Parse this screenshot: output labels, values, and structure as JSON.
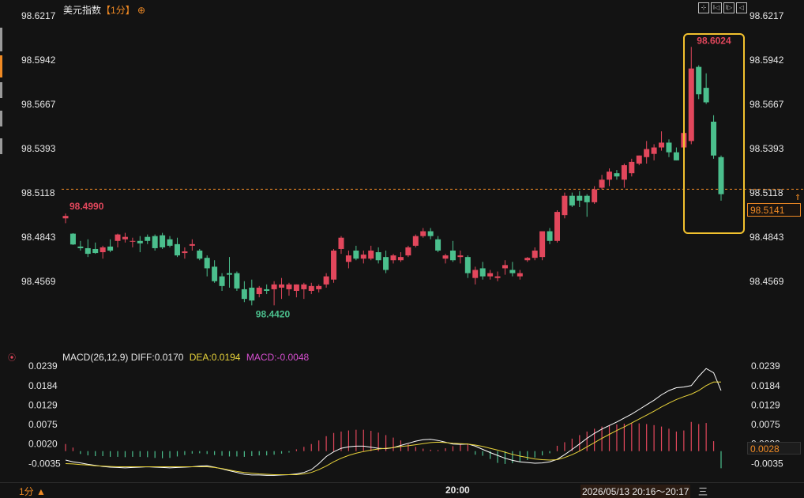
{
  "header": {
    "title": "美元指数",
    "period_tag": "【1分】",
    "toolbar": [
      "⊹",
      "I◁",
      "I▷",
      "◁"
    ]
  },
  "colors": {
    "up": "#e2475c",
    "down": "#4bbf8d",
    "highlight": "#f2c12e",
    "accent": "#f08a24",
    "diff_line": "#ffffff",
    "dea_line": "#e8d33a",
    "macd_label": "#d64fd0"
  },
  "chart_data": [
    {
      "type": "candlestick",
      "title": "美元指数【1分】",
      "ylim": [
        98.4294,
        98.6217
      ],
      "y_ticks": [
        "98.6217",
        "98.5942",
        "98.5667",
        "98.5393",
        "98.5118",
        "98.4843",
        "98.4569"
      ],
      "x_label": "20:00",
      "reference_line": 98.5141,
      "last_price_label": "98.5141",
      "annotations": {
        "high": "98.6024",
        "low": "98.4420",
        "start_high": "98.4990"
      },
      "candles": [
        {
          "o": 98.496,
          "h": 98.499,
          "l": 98.493,
          "c": 98.4975
        },
        {
          "o": 98.4865,
          "h": 98.4868,
          "l": 98.4795,
          "c": 98.4798
        },
        {
          "o": 98.4785,
          "h": 98.482,
          "l": 98.476,
          "c": 98.4775
        },
        {
          "o": 98.4775,
          "h": 98.483,
          "l": 98.472,
          "c": 98.474
        },
        {
          "o": 98.477,
          "h": 98.481,
          "l": 98.474,
          "c": 98.4745
        },
        {
          "o": 98.475,
          "h": 98.479,
          "l": 98.471,
          "c": 98.478
        },
        {
          "o": 98.4785,
          "h": 98.483,
          "l": 98.475,
          "c": 98.476
        },
        {
          "o": 98.482,
          "h": 98.4865,
          "l": 98.478,
          "c": 98.486
        },
        {
          "o": 98.483,
          "h": 98.487,
          "l": 98.481,
          "c": 98.4845
        },
        {
          "o": 98.4815,
          "h": 98.484,
          "l": 98.478,
          "c": 98.482
        },
        {
          "o": 98.482,
          "h": 98.485,
          "l": 98.475,
          "c": 98.4805
        },
        {
          "o": 98.4845,
          "h": 98.486,
          "l": 98.48,
          "c": 98.482
        },
        {
          "o": 98.485,
          "h": 98.486,
          "l": 98.476,
          "c": 98.4775
        },
        {
          "o": 98.4855,
          "h": 98.487,
          "l": 98.477,
          "c": 98.478
        },
        {
          "o": 98.483,
          "h": 98.485,
          "l": 98.478,
          "c": 98.479
        },
        {
          "o": 98.48,
          "h": 98.484,
          "l": 98.472,
          "c": 98.473
        },
        {
          "o": 98.4745,
          "h": 98.478,
          "l": 98.471,
          "c": 98.4755
        },
        {
          "o": 98.479,
          "h": 98.483,
          "l": 98.476,
          "c": 98.48
        },
        {
          "o": 98.476,
          "h": 98.477,
          "l": 98.47,
          "c": 98.471
        },
        {
          "o": 98.4715,
          "h": 98.473,
          "l": 98.46,
          "c": 98.465
        },
        {
          "o": 98.466,
          "h": 98.47,
          "l": 98.456,
          "c": 98.457
        },
        {
          "o": 98.46,
          "h": 98.462,
          "l": 98.451,
          "c": 98.454
        },
        {
          "o": 98.462,
          "h": 98.472,
          "l": 98.453,
          "c": 98.461
        },
        {
          "o": 98.462,
          "h": 98.463,
          "l": 98.451,
          "c": 98.4525
        },
        {
          "o": 98.452,
          "h": 98.457,
          "l": 98.444,
          "c": 98.446
        },
        {
          "o": 98.453,
          "h": 98.458,
          "l": 98.442,
          "c": 98.445
        },
        {
          "o": 98.449,
          "h": 98.454,
          "l": 98.447,
          "c": 98.453
        },
        {
          "o": 98.452,
          "h": 98.455,
          "l": 98.449,
          "c": 98.451
        },
        {
          "o": 98.452,
          "h": 98.457,
          "l": 98.442,
          "c": 98.455
        },
        {
          "o": 98.453,
          "h": 98.459,
          "l": 98.446,
          "c": 98.455
        },
        {
          "o": 98.452,
          "h": 98.456,
          "l": 98.448,
          "c": 98.455
        },
        {
          "o": 98.451,
          "h": 98.455,
          "l": 98.447,
          "c": 98.455
        },
        {
          "o": 98.452,
          "h": 98.456,
          "l": 98.446,
          "c": 98.455
        },
        {
          "o": 98.451,
          "h": 98.456,
          "l": 98.449,
          "c": 98.454
        },
        {
          "o": 98.452,
          "h": 98.455,
          "l": 98.45,
          "c": 98.454
        },
        {
          "o": 98.455,
          "h": 98.462,
          "l": 98.453,
          "c": 98.46
        },
        {
          "o": 98.458,
          "h": 98.477,
          "l": 98.456,
          "c": 98.476
        },
        {
          "o": 98.477,
          "h": 98.485,
          "l": 98.474,
          "c": 98.484
        },
        {
          "o": 98.469,
          "h": 98.476,
          "l": 98.465,
          "c": 98.473
        },
        {
          "o": 98.476,
          "h": 98.479,
          "l": 98.47,
          "c": 98.471
        },
        {
          "o": 98.471,
          "h": 98.476,
          "l": 98.468,
          "c": 98.4735
        },
        {
          "o": 98.471,
          "h": 98.479,
          "l": 98.47,
          "c": 98.476
        },
        {
          "o": 98.475,
          "h": 98.478,
          "l": 98.468,
          "c": 98.47
        },
        {
          "o": 98.472,
          "h": 98.476,
          "l": 98.462,
          "c": 98.464
        },
        {
          "o": 98.47,
          "h": 98.474,
          "l": 98.468,
          "c": 98.473
        },
        {
          "o": 98.47,
          "h": 98.475,
          "l": 98.469,
          "c": 98.472
        },
        {
          "o": 98.473,
          "h": 98.479,
          "l": 98.472,
          "c": 98.478
        },
        {
          "o": 98.479,
          "h": 98.486,
          "l": 98.478,
          "c": 98.485
        },
        {
          "o": 98.485,
          "h": 98.49,
          "l": 98.484,
          "c": 98.488
        },
        {
          "o": 98.488,
          "h": 98.49,
          "l": 98.483,
          "c": 98.485
        },
        {
          "o": 98.483,
          "h": 98.485,
          "l": 98.475,
          "c": 98.476
        },
        {
          "o": 98.471,
          "h": 98.474,
          "l": 98.468,
          "c": 98.473
        },
        {
          "o": 98.476,
          "h": 98.482,
          "l": 98.469,
          "c": 98.47
        },
        {
          "o": 98.472,
          "h": 98.476,
          "l": 98.468,
          "c": 98.473
        },
        {
          "o": 98.472,
          "h": 98.473,
          "l": 98.459,
          "c": 98.462
        },
        {
          "o": 98.459,
          "h": 98.466,
          "l": 98.455,
          "c": 98.464
        },
        {
          "o": 98.465,
          "h": 98.469,
          "l": 98.458,
          "c": 98.46
        },
        {
          "o": 98.46,
          "h": 98.464,
          "l": 98.458,
          "c": 98.462
        },
        {
          "o": 98.459,
          "h": 98.463,
          "l": 98.457,
          "c": 98.46
        },
        {
          "o": 98.465,
          "h": 98.47,
          "l": 98.461,
          "c": 98.467
        },
        {
          "o": 98.464,
          "h": 98.469,
          "l": 98.46,
          "c": 98.462
        },
        {
          "o": 98.46,
          "h": 98.464,
          "l": 98.458,
          "c": 98.462
        },
        {
          "o": 98.47,
          "h": 98.472,
          "l": 98.469,
          "c": 98.4715
        },
        {
          "o": 98.4715,
          "h": 98.478,
          "l": 98.47,
          "c": 98.476
        },
        {
          "o": 98.472,
          "h": 98.484,
          "l": 98.47,
          "c": 98.488
        },
        {
          "o": 98.488,
          "h": 98.49,
          "l": 98.48,
          "c": 98.482
        },
        {
          "o": 98.482,
          "h": 98.501,
          "l": 98.481,
          "c": 98.5
        },
        {
          "o": 98.498,
          "h": 98.512,
          "l": 98.496,
          "c": 98.51
        },
        {
          "o": 98.51,
          "h": 98.512,
          "l": 98.503,
          "c": 98.504
        },
        {
          "o": 98.51,
          "h": 98.513,
          "l": 98.503,
          "c": 98.507
        },
        {
          "o": 98.51,
          "h": 98.511,
          "l": 98.497,
          "c": 98.506
        },
        {
          "o": 98.506,
          "h": 98.516,
          "l": 98.505,
          "c": 98.514
        },
        {
          "o": 98.515,
          "h": 98.523,
          "l": 98.514,
          "c": 98.52
        },
        {
          "o": 98.52,
          "h": 98.527,
          "l": 98.516,
          "c": 98.525
        },
        {
          "o": 98.524,
          "h": 98.526,
          "l": 98.52,
          "c": 98.522
        },
        {
          "o": 98.52,
          "h": 98.53,
          "l": 98.515,
          "c": 98.529
        },
        {
          "o": 98.524,
          "h": 98.533,
          "l": 98.522,
          "c": 98.531
        },
        {
          "o": 98.53,
          "h": 98.535,
          "l": 98.529,
          "c": 98.535
        },
        {
          "o": 98.534,
          "h": 98.544,
          "l": 98.53,
          "c": 98.539
        },
        {
          "o": 98.536,
          "h": 98.542,
          "l": 98.532,
          "c": 98.54
        },
        {
          "o": 98.54,
          "h": 98.55,
          "l": 98.538,
          "c": 98.543
        },
        {
          "o": 98.543,
          "h": 98.545,
          "l": 98.534,
          "c": 98.537
        },
        {
          "o": 98.537,
          "h": 98.54,
          "l": 98.532,
          "c": 98.532
        },
        {
          "o": 98.54,
          "h": 98.552,
          "l": 98.533,
          "c": 98.549
        },
        {
          "o": 98.544,
          "h": 98.6024,
          "l": 98.542,
          "c": 98.589
        },
        {
          "o": 98.59,
          "h": 98.591,
          "l": 98.57,
          "c": 98.573
        },
        {
          "o": 98.577,
          "h": 98.586,
          "l": 98.567,
          "c": 98.568
        },
        {
          "o": 98.556,
          "h": 98.56,
          "l": 98.533,
          "c": 98.535
        },
        {
          "o": 98.534,
          "h": 98.535,
          "l": 98.507,
          "c": 98.511
        }
      ]
    },
    {
      "type": "macd",
      "legend": {
        "name": "MACD(26,12,9)",
        "diff": "DIFF:0.0170",
        "dea": "DEA:0.0194",
        "macd": "MACD:-0.0048"
      },
      "ylim": [
        -0.0065,
        0.0239
      ],
      "y_ticks": [
        "0.0239",
        "0.0184",
        "0.0129",
        "0.0075",
        "0.0020",
        "-0.0035"
      ],
      "last_value_label": "0.0028",
      "histogram": [
        0.002,
        0.001,
        -0.0008,
        -0.0012,
        -0.0014,
        -0.0014,
        -0.0016,
        -0.0016,
        -0.0017,
        -0.0016,
        -0.0016,
        -0.0017,
        -0.0019,
        -0.002,
        -0.0019,
        -0.0015,
        -0.0011,
        -0.0007,
        -0.0006,
        -0.0008,
        -0.0011,
        -0.0013,
        -0.0015,
        -0.0015,
        -0.0016,
        -0.0014,
        -0.0012,
        -0.0012,
        -0.001,
        -0.0007,
        -0.0004,
        0.0005,
        0.0012,
        0.002,
        0.003,
        0.0042,
        0.0051,
        0.0055,
        0.0058,
        0.006,
        0.006,
        0.0057,
        0.0052,
        0.0045,
        0.0038,
        0.003,
        0.002,
        0.0012,
        0.0007,
        0.0004,
        0.0003,
        0.0008,
        0.0014,
        0.0018,
        0.002,
        -0.001,
        -0.0013,
        -0.0022,
        -0.0033,
        -0.0036,
        -0.0034,
        -0.003,
        -0.0025,
        -0.0018,
        -0.0012,
        -0.0006,
        0.0015,
        0.0025,
        0.0035,
        0.0045,
        0.0055,
        0.0063,
        0.0069,
        0.0073,
        0.0075,
        0.0077,
        0.0078,
        0.0078,
        0.0076,
        0.0073,
        0.0069,
        0.0063,
        0.0055,
        0.0058,
        0.0082,
        0.0076,
        0.0079,
        0.0028,
        -0.0048
      ],
      "diff": [
        -0.0025,
        -0.003,
        -0.0033,
        -0.0037,
        -0.004,
        -0.0043,
        -0.0045,
        -0.0046,
        -0.0047,
        -0.0046,
        -0.0045,
        -0.0044,
        -0.0045,
        -0.0046,
        -0.0047,
        -0.0046,
        -0.0045,
        -0.0044,
        -0.0042,
        -0.0041,
        -0.0045,
        -0.005,
        -0.0055,
        -0.006,
        -0.0065,
        -0.0067,
        -0.0067,
        -0.0068,
        -0.0068,
        -0.0067,
        -0.0066,
        -0.0064,
        -0.006,
        -0.0052,
        -0.0035,
        -0.0015,
        -0.0002,
        0.0008,
        0.0012,
        0.0014,
        0.0014,
        0.0011,
        0.0008,
        0.0007,
        0.001,
        0.0016,
        0.0022,
        0.0028,
        0.0032,
        0.0033,
        0.003,
        0.0025,
        0.002,
        0.0019,
        0.002,
        0.0014,
        0.0005,
        -0.0004,
        -0.0012,
        -0.002,
        -0.0026,
        -0.003,
        -0.0032,
        -0.0034,
        -0.0033,
        -0.003,
        -0.0023,
        -0.001,
        0.0005,
        0.002,
        0.0036,
        0.005,
        0.0062,
        0.0072,
        0.0082,
        0.0093,
        0.0104,
        0.0117,
        0.013,
        0.0143,
        0.0158,
        0.017,
        0.0178,
        0.018,
        0.0184,
        0.021,
        0.0232,
        0.022,
        0.017
      ],
      "dea": [
        -0.0035,
        -0.0036,
        -0.0038,
        -0.0039,
        -0.0041,
        -0.0042,
        -0.0043,
        -0.0044,
        -0.0044,
        -0.0044,
        -0.0044,
        -0.0044,
        -0.0044,
        -0.0044,
        -0.0044,
        -0.0044,
        -0.0044,
        -0.0044,
        -0.0044,
        -0.0044,
        -0.0046,
        -0.0049,
        -0.0053,
        -0.0057,
        -0.006,
        -0.0062,
        -0.0064,
        -0.0065,
        -0.0066,
        -0.0066,
        -0.0066,
        -0.0066,
        -0.0064,
        -0.006,
        -0.0052,
        -0.0042,
        -0.003,
        -0.002,
        -0.0012,
        -0.0006,
        -0.0001,
        0.0003,
        0.0006,
        0.0008,
        0.001,
        0.0013,
        0.0015,
        0.0018,
        0.0021,
        0.0024,
        0.0025,
        0.0024,
        0.0022,
        0.0021,
        0.002,
        0.0017,
        0.0013,
        0.0008,
        0.0003,
        -0.0003,
        -0.0009,
        -0.0014,
        -0.0018,
        -0.0022,
        -0.0024,
        -0.0025,
        -0.0024,
        -0.0018,
        -0.001,
        0.0,
        0.0012,
        0.0024,
        0.0036,
        0.0047,
        0.0058,
        0.0068,
        0.0079,
        0.009,
        0.0101,
        0.0112,
        0.0124,
        0.0135,
        0.0145,
        0.0153,
        0.016,
        0.017,
        0.0184,
        0.0194,
        0.0194
      ]
    }
  ],
  "x_axis": {
    "label": "20:00"
  },
  "footer": {
    "period": "1分 ▲",
    "range": "2026/05/13 20:16～20:17",
    "menu_icon": "三"
  }
}
